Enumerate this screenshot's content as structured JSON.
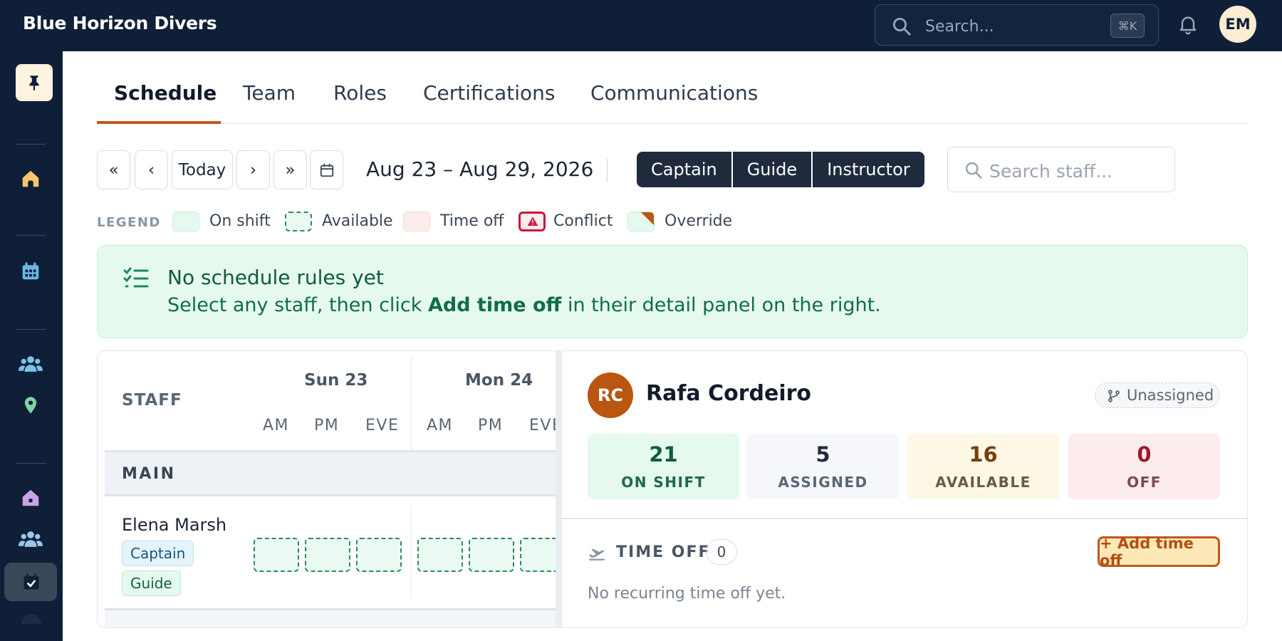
{
  "app": {
    "brand": "Blue Horizon Divers"
  },
  "topbar": {
    "search_placeholder": "Search...",
    "shortcut": "⌘K",
    "user_initials": "EM"
  },
  "tabs": [
    {
      "label": "Schedule",
      "active": true
    },
    {
      "label": "Team"
    },
    {
      "label": "Roles"
    },
    {
      "label": "Certifications"
    },
    {
      "label": "Communications"
    }
  ],
  "toolbar": {
    "first_symbol": "«",
    "prev_symbol": "‹",
    "today_label": "Today",
    "next_symbol": "›",
    "last_symbol": "»",
    "date_range": "Aug 23 – Aug 29, 2026",
    "role_filters": [
      "Captain",
      "Guide",
      "Instructor"
    ],
    "staff_search_placeholder": "Search staff..."
  },
  "legend": {
    "title": "LEGEND",
    "items": [
      {
        "label": "On shift"
      },
      {
        "label": "Available"
      },
      {
        "label": "Time off"
      },
      {
        "label": "Conflict"
      },
      {
        "label": "Override"
      }
    ]
  },
  "banner": {
    "title": "No schedule rules yet",
    "text_before": "Select any staff, then click ",
    "text_bold": "Add time off",
    "text_after": " in their detail panel on the right."
  },
  "grid": {
    "staff_header": "STAFF",
    "days": [
      {
        "label": "Sun 23",
        "slots": [
          "AM",
          "PM",
          "EVE"
        ]
      },
      {
        "label": "Mon 24",
        "slots": [
          "AM",
          "PM",
          "EVE"
        ]
      }
    ],
    "section": "MAIN",
    "rows": [
      {
        "name": "Elena Marsh",
        "roles": [
          "Captain",
          "Guide"
        ]
      }
    ]
  },
  "detail": {
    "initials": "RC",
    "name": "Rafa Cordeiro",
    "assignment": "Unassigned",
    "stats": [
      {
        "value": "21",
        "label": "ON SHIFT"
      },
      {
        "value": "5",
        "label": "ASSIGNED"
      },
      {
        "value": "16",
        "label": "AVAILABLE"
      },
      {
        "value": "0",
        "label": "OFF"
      }
    ],
    "time_off_title": "TIME OFF",
    "time_off_count": "0",
    "add_time_off_label": "+ Add time off",
    "empty_text": "No recurring time off yet."
  },
  "colors": {
    "navy": "#0f1f38",
    "accent": "#c2581c",
    "on_shift": "#e6f9ef",
    "available_border": "#2f8a5b",
    "time_off": "#fdecec",
    "conflict": "#c8193c"
  }
}
